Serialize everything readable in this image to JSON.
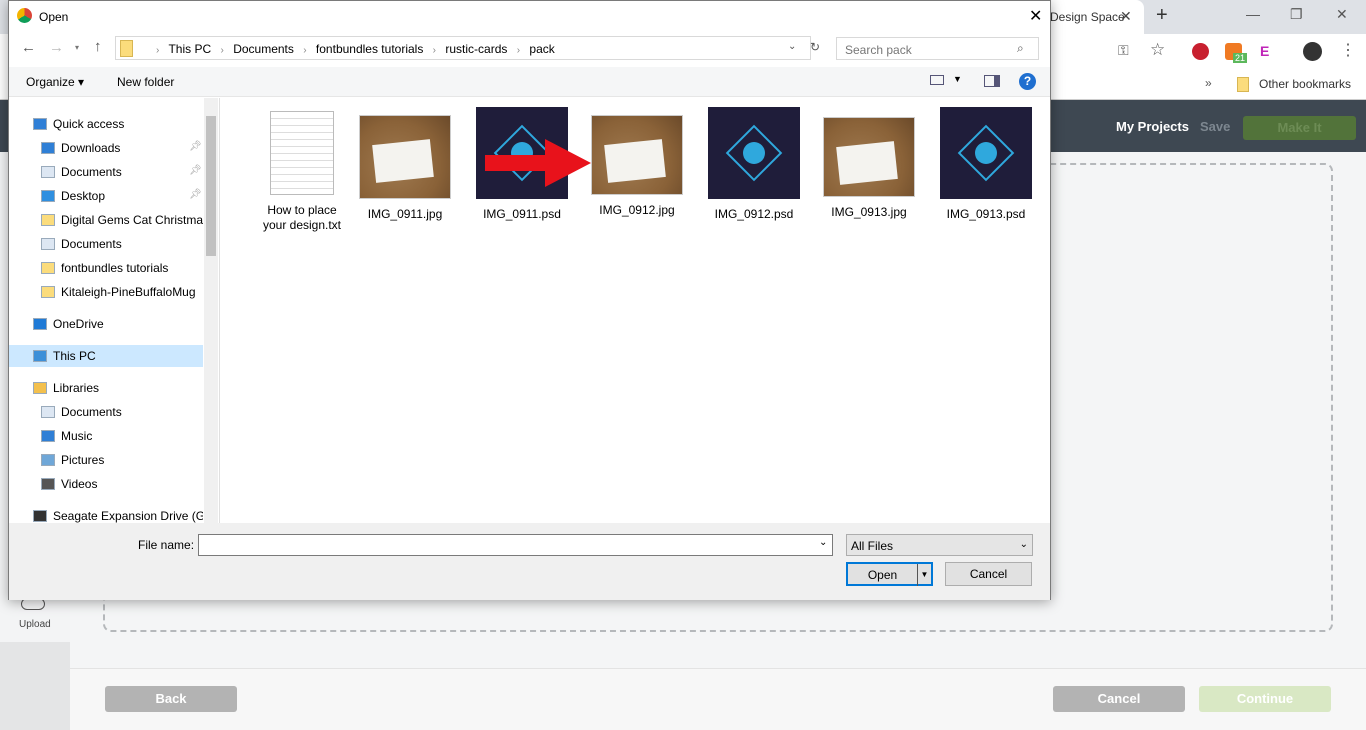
{
  "browser": {
    "tab_title": "Design Space",
    "bookmarks_more": "»",
    "other_bookmarks": "Other bookmarks",
    "extension_badge": "21"
  },
  "app": {
    "my_projects": "My Projects",
    "save": "Save",
    "make_it": "Make It",
    "upload": "Upload",
    "back": "Back",
    "cancel": "Cancel",
    "continue": "Continue",
    "accent": "#52733a"
  },
  "dialog": {
    "title": "Open",
    "breadcrumb": [
      "This PC",
      "Documents",
      "fontbundles tutorials",
      "rustic-cards",
      "pack"
    ],
    "search_placeholder": "Search pack",
    "organize": "Organize ▾",
    "new_folder": "New folder",
    "nav": [
      {
        "label": "Quick access",
        "icon": "star-icon"
      },
      {
        "label": "Downloads",
        "icon": "download-icon",
        "pinned": true
      },
      {
        "label": "Documents",
        "icon": "document-icon",
        "pinned": true
      },
      {
        "label": "Desktop",
        "icon": "desktop-icon",
        "pinned": true
      },
      {
        "label": "Digital Gems Cat Christmas",
        "icon": "folder-icon"
      },
      {
        "label": "Documents",
        "icon": "document-icon"
      },
      {
        "label": "fontbundles tutorials",
        "icon": "folder-icon"
      },
      {
        "label": "Kitaleigh-PineBuffaloMug",
        "icon": "folder-icon"
      },
      {
        "label": "OneDrive",
        "icon": "cloud-icon"
      },
      {
        "label": "This PC",
        "icon": "computer-icon",
        "selected": true
      },
      {
        "label": "Libraries",
        "icon": "library-icon"
      },
      {
        "label": "Documents",
        "icon": "document-icon"
      },
      {
        "label": "Music",
        "icon": "music-icon"
      },
      {
        "label": "Pictures",
        "icon": "picture-icon"
      },
      {
        "label": "Videos",
        "icon": "video-icon"
      },
      {
        "label": "Seagate Expansion Drive (G:)",
        "icon": "drive-icon"
      }
    ],
    "files": [
      {
        "name": "How to place your design.txt",
        "type": "txt"
      },
      {
        "name": "IMG_0911.jpg",
        "type": "jpg"
      },
      {
        "name": "IMG_0911.psd",
        "type": "psd"
      },
      {
        "name": "IMG_0912.jpg",
        "type": "jpg"
      },
      {
        "name": "IMG_0912.psd",
        "type": "psd"
      },
      {
        "name": "IMG_0913.jpg",
        "type": "jpg"
      },
      {
        "name": "IMG_0913.psd",
        "type": "psd"
      }
    ],
    "file_name_label": "File name:",
    "file_name_value": "",
    "file_type": "All Files",
    "open": "Open",
    "cancel": "Cancel"
  }
}
